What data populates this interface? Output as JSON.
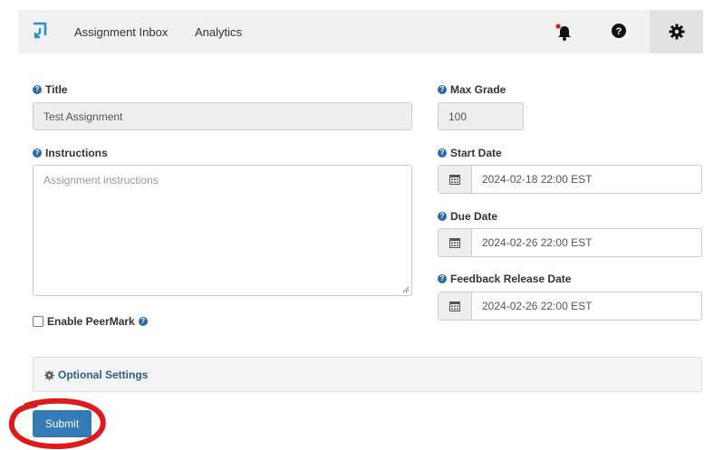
{
  "nav": {
    "assignment_inbox": "Assignment Inbox",
    "analytics": "Analytics"
  },
  "icons": {
    "logo": "logo-icon",
    "notifications": "bell-icon",
    "help": "question-icon",
    "settings": "gear-icon",
    "calendar": "calendar-icon"
  },
  "colors": {
    "brand": "#2b6ca8",
    "notification_dot": "#e02020",
    "submit": "#337ab7",
    "annotation": "#e01a1a"
  },
  "form": {
    "title": {
      "label": "Title",
      "value": "Test Assignment"
    },
    "instructions": {
      "label": "Instructions",
      "placeholder": "Assignment instructions"
    },
    "max_grade": {
      "label": "Max Grade",
      "value": "100"
    },
    "start_date": {
      "label": "Start Date",
      "value": "2024-02-18 22:00 EST"
    },
    "due_date": {
      "label": "Due Date",
      "value": "2024-02-26 22:00 EST"
    },
    "feedback_date": {
      "label": "Feedback Release Date",
      "value": "2024-02-26 22:00 EST"
    },
    "peermark": {
      "label": "Enable PeerMark",
      "checked": false
    },
    "optional_settings": "Optional Settings",
    "submit": "Submit"
  }
}
